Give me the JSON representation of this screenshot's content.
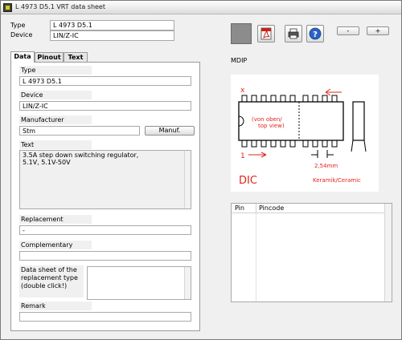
{
  "window": {
    "title": "L 4973 D5.1 VRT data sheet"
  },
  "header": {
    "type_label": "Type",
    "type_value": "L 4973 D5.1",
    "device_label": "Device",
    "device_value": "LIN/Z-IC"
  },
  "toolbar": {
    "pdf_icon_text": "PDF",
    "help_icon_text": "?",
    "zoom_out_label": "-",
    "zoom_in_label": "+"
  },
  "tabs": [
    {
      "label": "Data",
      "active": true
    },
    {
      "label": "Pinout",
      "active": false
    },
    {
      "label": "Text",
      "active": false
    }
  ],
  "data_panel": {
    "type_label": "Type",
    "type_value": "L 4973 D5.1",
    "device_label": "Device",
    "device_value": "LIN/Z-IC",
    "manufacturer_label": "Manufacturer",
    "manufacturer_value": "Stm",
    "manuf_button": "Manuf.",
    "text_label": "Text",
    "text_lines": [
      "3.5A step down switching regulator,",
      "5.1V, 5.1V-50V"
    ],
    "replacement_label": "Replacement",
    "replacement_value": "-",
    "complementary_label": "Complementary",
    "complementary_value": "",
    "datasheet_label_lines": [
      "Data sheet of the",
      "replacement type",
      "(double click!)"
    ],
    "remark_label": "Remark",
    "remark_value": ""
  },
  "package": {
    "name": "MDIP",
    "drawing": {
      "pin_marker": "x",
      "view_note_lines": [
        "(von oben/",
        "top view)"
      ],
      "pin_one": "1",
      "pitch": "2,54mm",
      "type": "DIC",
      "material": "Keramik/Ceramic"
    }
  },
  "pin_table": {
    "columns": [
      "Pin",
      "Pincode"
    ],
    "rows": []
  },
  "colors": {
    "window_bg": "#f0f0f0",
    "drawing_red": "#e0241b",
    "swatch": "#8c8c8c"
  }
}
